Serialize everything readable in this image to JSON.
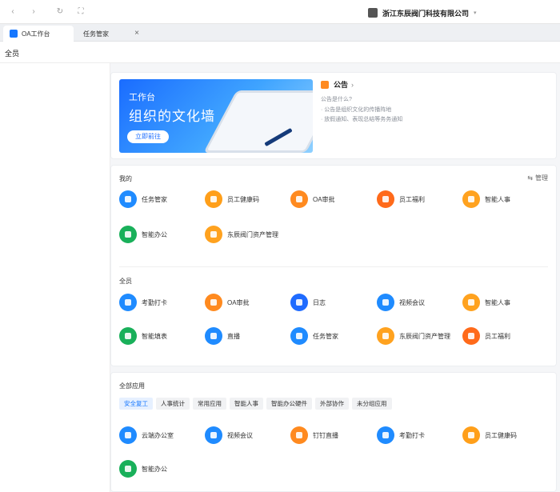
{
  "window": {
    "org_name": "浙江东辰阀门科技有限公司",
    "nav_back": "‹",
    "nav_forward": "›",
    "nav_refresh": "↻",
    "nav_fullscreen": "⛶",
    "org_caret": "▾"
  },
  "tabs": [
    {
      "label": "OA工作台",
      "active": true
    },
    {
      "label": "任务管家",
      "active": false,
      "close": "×"
    }
  ],
  "subheader": {
    "title": "全员"
  },
  "banner": {
    "subtitle": "工作台",
    "title": "组织的文化墙",
    "cta": "立即前往"
  },
  "notice": {
    "title": "公告",
    "chevron": "›",
    "question": "公告是什么?",
    "point1": "· 公告是组织文化的传播阵地",
    "point2": "· 放假通知、表现总结等务务通知"
  },
  "mine": {
    "title": "我的",
    "manage": "管理",
    "manage_icon": "⇆",
    "apps": [
      {
        "label": "任务管家",
        "color": "#1f8bff"
      },
      {
        "label": "员工健康码",
        "color": "#ff9f1a"
      },
      {
        "label": "OA审批",
        "color": "#ff8a1f"
      },
      {
        "label": "员工福利",
        "color": "#ff6a1a"
      },
      {
        "label": "智能人事",
        "color": "#ffa21f"
      },
      {
        "label": "智能办公",
        "color": "#19b05a"
      },
      {
        "label": "东辰阀门资产管理",
        "color": "#ffa21f"
      }
    ]
  },
  "all": {
    "title": "全员",
    "apps": [
      {
        "label": "考勤打卡",
        "color": "#1f8bff"
      },
      {
        "label": "OA审批",
        "color": "#ff8a1f"
      },
      {
        "label": "日志",
        "color": "#1f6bff"
      },
      {
        "label": "视频会议",
        "color": "#1f8bff"
      },
      {
        "label": "智能人事",
        "color": "#ffa21f"
      },
      {
        "label": "智能填表",
        "color": "#19b05a"
      },
      {
        "label": "直播",
        "color": "#1f8bff"
      },
      {
        "label": "任务管家",
        "color": "#1f8bff"
      },
      {
        "label": "东辰阀门资产管理",
        "color": "#ffa21f"
      },
      {
        "label": "员工福利",
        "color": "#ff6a1a"
      }
    ]
  },
  "all_apps": {
    "title": "全部应用",
    "chips": [
      {
        "label": "安全复工",
        "active": true
      },
      {
        "label": "人事统计",
        "active": false
      },
      {
        "label": "常用应用",
        "active": false
      },
      {
        "label": "智能人事",
        "active": false
      },
      {
        "label": "智能办公硬件",
        "active": false
      },
      {
        "label": "外部协作",
        "active": false
      },
      {
        "label": "未分组应用",
        "active": false
      }
    ],
    "apps": [
      {
        "label": "云端办公室",
        "color": "#1f8bff"
      },
      {
        "label": "视频会议",
        "color": "#1f8bff"
      },
      {
        "label": "钉钉直播",
        "color": "#ff8a1f"
      },
      {
        "label": "考勤打卡",
        "color": "#1f8bff"
      },
      {
        "label": "员工健康码",
        "color": "#ff9f1a"
      },
      {
        "label": "智能办公",
        "color": "#19b05a"
      }
    ]
  }
}
